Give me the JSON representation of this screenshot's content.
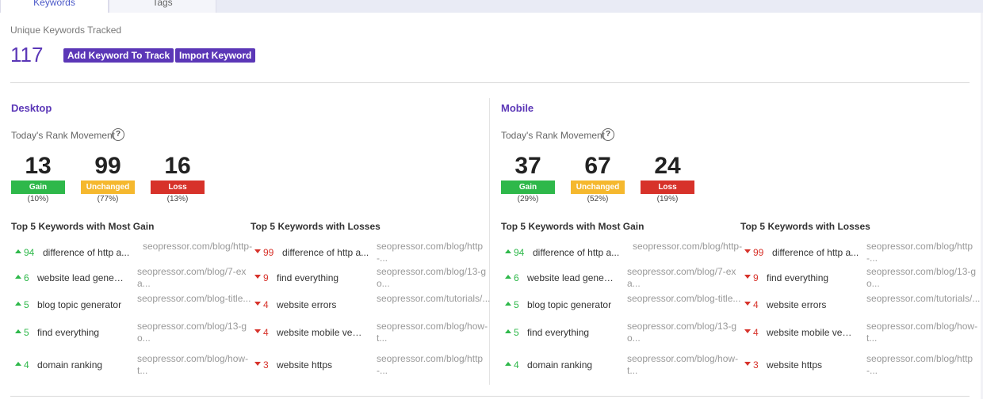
{
  "tabs": [
    {
      "label": "Keywords",
      "active": true
    },
    {
      "label": "Tags",
      "active": false
    }
  ],
  "summary": {
    "label": "Unique Keywords Tracked",
    "count": "117",
    "add_button": "Add Keyword To Track",
    "import_button": "Import Keyword"
  },
  "colors": {
    "accent": "#5b37b7",
    "gain": "#2eb84a",
    "unchanged": "#f5b82e",
    "loss": "#d7322a"
  },
  "desktop": {
    "title": "Desktop",
    "rank_label": "Today's Rank Movement",
    "help_icon": "?",
    "gain": {
      "value": "13",
      "label": "Gain",
      "pct": "(10%)"
    },
    "unchanged": {
      "value": "99",
      "label": "Unchanged",
      "pct": "(77%)"
    },
    "loss": {
      "value": "16",
      "label": "Loss",
      "pct": "(13%)"
    },
    "gain_heading": "Top 5 Keywords with Most Gain",
    "loss_heading": "Top 5 Keywords with Losses",
    "gains": [
      {
        "delta": "94",
        "keyword": "difference of http a...",
        "url": "seopressor.com/blog/http-"
      },
      {
        "delta": "6",
        "keyword": "website lead generat...",
        "url": "seopressor.com/blog/7-exa..."
      },
      {
        "delta": "5",
        "keyword": "blog topic generator",
        "url": "seopressor.com/blog-title..."
      },
      {
        "delta": "5",
        "keyword": "find everything",
        "url": "seopressor.com/blog/13-go..."
      },
      {
        "delta": "4",
        "keyword": "domain ranking",
        "url": "seopressor.com/blog/how-t..."
      }
    ],
    "losses": [
      {
        "delta": "99",
        "keyword": "difference of http a...",
        "url": "seopressor.com/blog/http-..."
      },
      {
        "delta": "9",
        "keyword": "find everything",
        "url": "seopressor.com/blog/13-go..."
      },
      {
        "delta": "4",
        "keyword": "website errors",
        "url": "seopressor.com/tutorials/..."
      },
      {
        "delta": "4",
        "keyword": "website mobile versi...",
        "url": "seopressor.com/blog/how-t..."
      },
      {
        "delta": "3",
        "keyword": "website https",
        "url": "seopressor.com/blog/http-..."
      }
    ]
  },
  "mobile": {
    "title": "Mobile",
    "rank_label": "Today's Rank Movement",
    "help_icon": "?",
    "gain": {
      "value": "37",
      "label": "Gain",
      "pct": "(29%)"
    },
    "unchanged": {
      "value": "67",
      "label": "Unchanged",
      "pct": "(52%)"
    },
    "loss": {
      "value": "24",
      "label": "Loss",
      "pct": "(19%)"
    },
    "gain_heading": "Top 5 Keywords with Most Gain",
    "loss_heading": "Top 5 Keywords with Losses",
    "gains": [
      {
        "delta": "94",
        "keyword": "difference of http a...",
        "url": "seopressor.com/blog/http-"
      },
      {
        "delta": "6",
        "keyword": "website lead generat...",
        "url": "seopressor.com/blog/7-exa..."
      },
      {
        "delta": "5",
        "keyword": "blog topic generator",
        "url": "seopressor.com/blog-title..."
      },
      {
        "delta": "5",
        "keyword": "find everything",
        "url": "seopressor.com/blog/13-go..."
      },
      {
        "delta": "4",
        "keyword": "domain ranking",
        "url": "seopressor.com/blog/how-t..."
      }
    ],
    "losses": [
      {
        "delta": "99",
        "keyword": "difference of http a...",
        "url": "seopressor.com/blog/http-..."
      },
      {
        "delta": "9",
        "keyword": "find everything",
        "url": "seopressor.com/blog/13-go..."
      },
      {
        "delta": "4",
        "keyword": "website errors",
        "url": "seopressor.com/tutorials/..."
      },
      {
        "delta": "4",
        "keyword": "website mobile versi...",
        "url": "seopressor.com/blog/how-t..."
      },
      {
        "delta": "3",
        "keyword": "website https",
        "url": "seopressor.com/blog/http-..."
      }
    ]
  }
}
